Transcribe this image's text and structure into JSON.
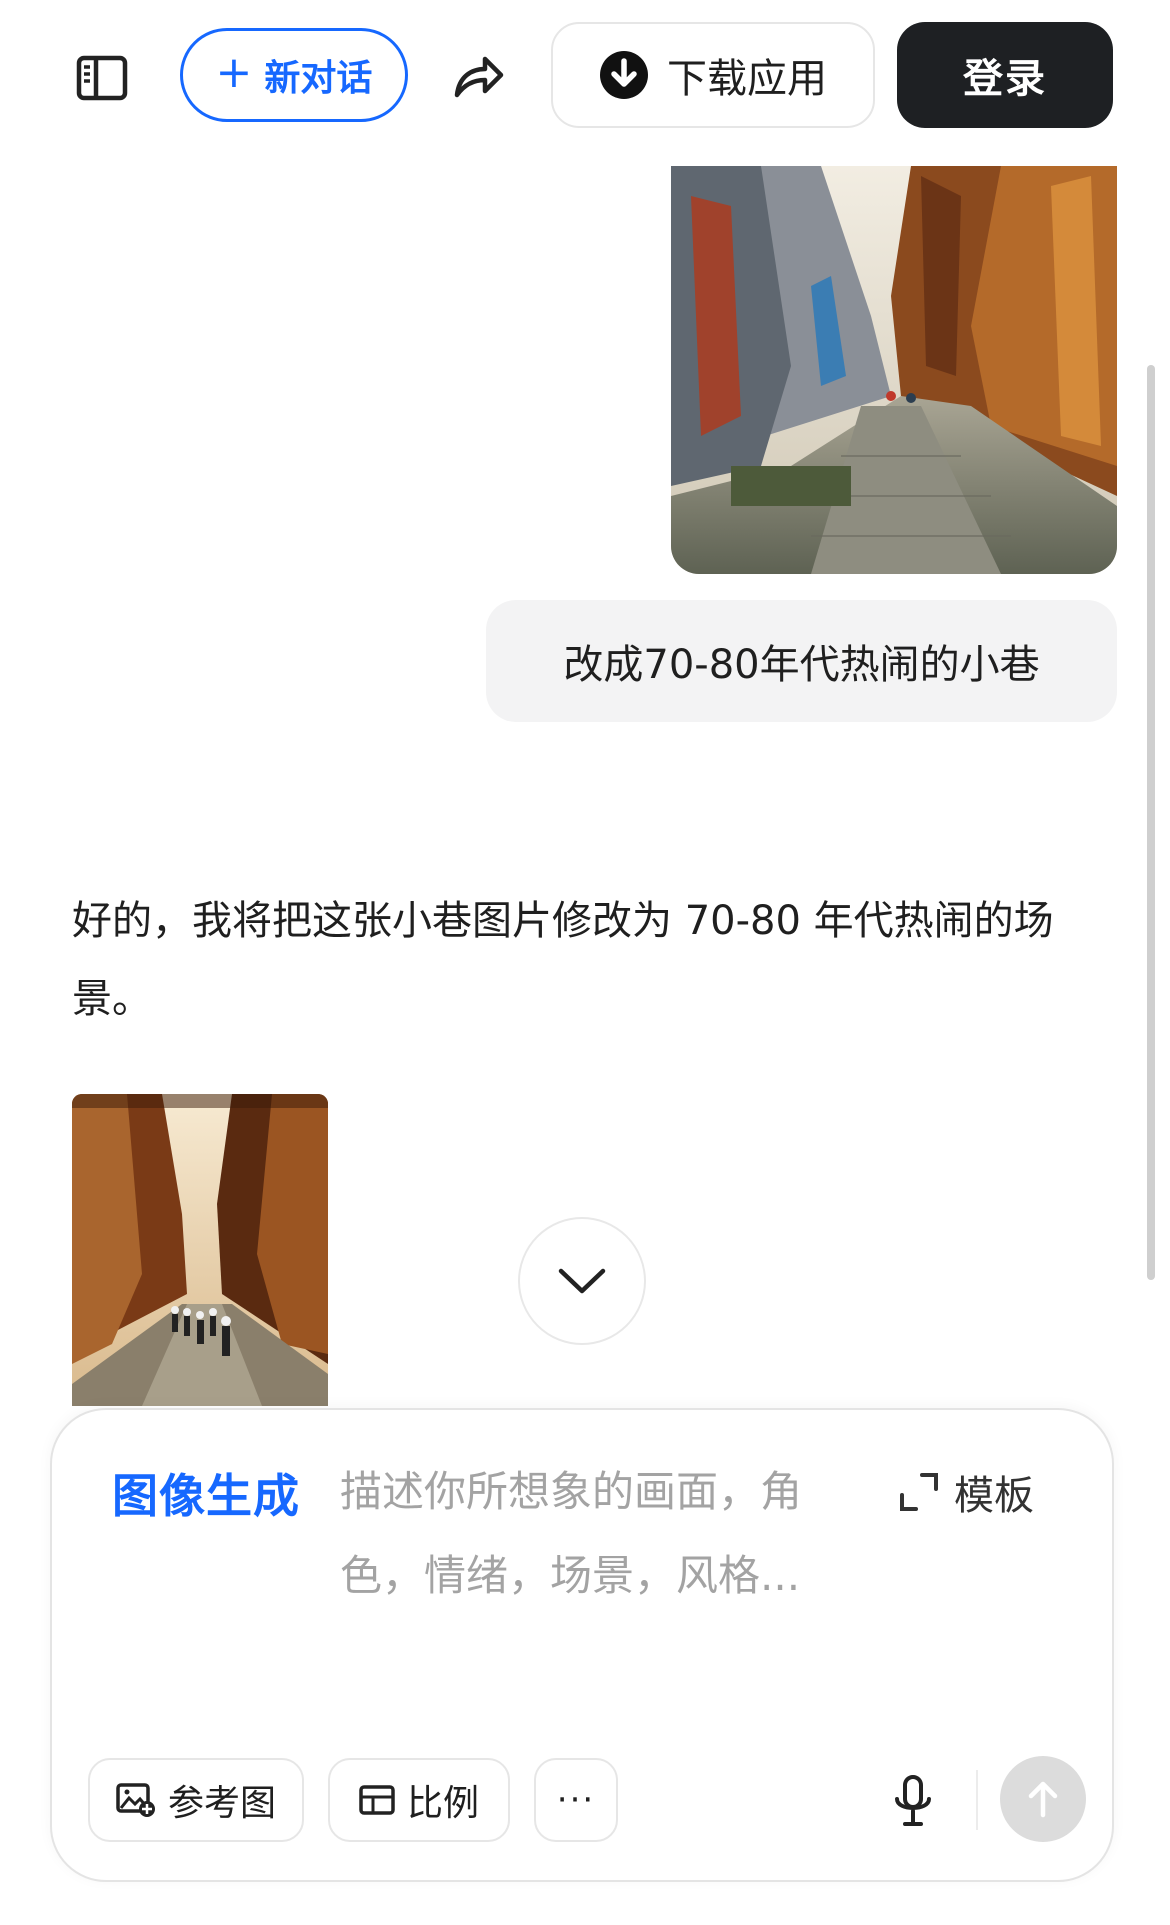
{
  "topbar": {
    "new_chat_label": "新对话",
    "download_label": "下载应用",
    "login_label": "登录"
  },
  "conversation": {
    "user_message": "改成70-80年代热闹的小巷",
    "assistant_message": "好的，我将把这张小巷图片修改为 70-80 年代热闹的场景。"
  },
  "composer": {
    "mode_label": "图像生成",
    "placeholder": "描述你所想象的画面，角色，情绪，场景，风格...",
    "template_label": "模板",
    "reference_label": "参考图",
    "ratio_label": "比例",
    "more_label": "···"
  },
  "icons": {
    "sidebar": "sidebar-icon",
    "share": "share-icon",
    "download": "download-icon",
    "expand": "expand-icon",
    "image_add": "image-add-icon",
    "ratio": "aspect-ratio-icon",
    "mic": "microphone-icon",
    "send": "arrow-up-icon",
    "scroll_down": "chevron-down-icon"
  },
  "colors": {
    "accent": "#1668ff",
    "login_bg": "#1e2023",
    "bubble_bg": "#f3f3f4",
    "send_disabled": "#dcdcdc"
  }
}
